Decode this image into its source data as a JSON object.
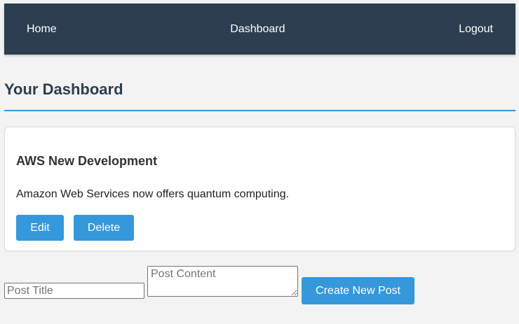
{
  "nav": {
    "home": "Home",
    "dashboard": "Dashboard",
    "logout": "Logout"
  },
  "page": {
    "title": "Your Dashboard"
  },
  "posts": [
    {
      "title": "AWS New Development",
      "content": "Amazon Web Services now offers quantum computing.",
      "edit_label": "Edit",
      "delete_label": "Delete"
    }
  ],
  "form": {
    "title_placeholder": "Post Title",
    "content_placeholder": "Post Content",
    "submit_label": "Create New Post"
  },
  "colors": {
    "navbar": "#2c3e50",
    "accent": "#3498db",
    "background": "#f3f3f3"
  }
}
